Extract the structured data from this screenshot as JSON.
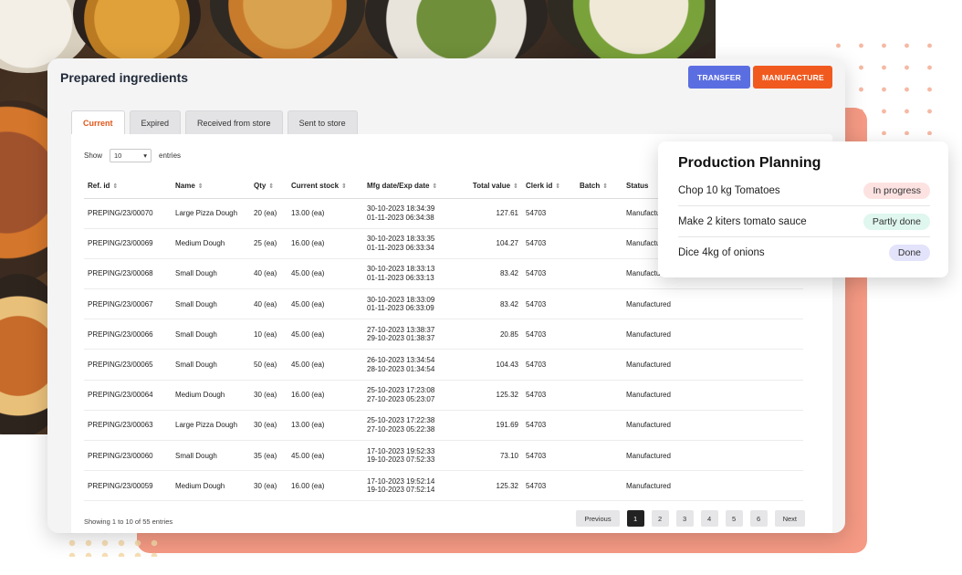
{
  "window": {
    "title": "Prepared ingredients"
  },
  "actions": {
    "transfer": "TRANSFER",
    "manufacture": "MANUFACTURE"
  },
  "tabs": [
    "Current",
    "Expired",
    "Received from store",
    "Sent to store"
  ],
  "length_menu": {
    "show": "Show",
    "value": "10",
    "entries": "entries"
  },
  "columns": [
    "Ref. id",
    "Name",
    "Qty",
    "Current stock",
    "Mfg date/Exp date",
    "Total value",
    "Clerk id",
    "Batch",
    "Status"
  ],
  "rows": [
    {
      "ref": "PREPING/23/00070",
      "name": "Large Pizza Dough",
      "qty": "20 (ea)",
      "stock": "13.00 (ea)",
      "mfg": "30-10-2023 18:34:39",
      "exp": "01-11-2023 06:34:38",
      "value": "127.61",
      "clerk": "54703",
      "batch": "",
      "status": "Manufactured"
    },
    {
      "ref": "PREPING/23/00069",
      "name": "Medium Dough",
      "qty": "25 (ea)",
      "stock": "16.00 (ea)",
      "mfg": "30-10-2023 18:33:35",
      "exp": "01-11-2023 06:33:34",
      "value": "104.27",
      "clerk": "54703",
      "batch": "",
      "status": "Manufactured"
    },
    {
      "ref": "PREPING/23/00068",
      "name": "Small Dough",
      "qty": "40 (ea)",
      "stock": "45.00 (ea)",
      "mfg": "30-10-2023 18:33:13",
      "exp": "01-11-2023 06:33:13",
      "value": "83.42",
      "clerk": "54703",
      "batch": "",
      "status": "Manufactured"
    },
    {
      "ref": "PREPING/23/00067",
      "name": "Small Dough",
      "qty": "40 (ea)",
      "stock": "45.00 (ea)",
      "mfg": "30-10-2023 18:33:09",
      "exp": "01-11-2023 06:33:09",
      "value": "83.42",
      "clerk": "54703",
      "batch": "",
      "status": "Manufactured"
    },
    {
      "ref": "PREPING/23/00066",
      "name": "Small Dough",
      "qty": "10 (ea)",
      "stock": "45.00 (ea)",
      "mfg": "27-10-2023 13:38:37",
      "exp": "29-10-2023 01:38:37",
      "value": "20.85",
      "clerk": "54703",
      "batch": "",
      "status": "Manufactured"
    },
    {
      "ref": "PREPING/23/00065",
      "name": "Small Dough",
      "qty": "50 (ea)",
      "stock": "45.00 (ea)",
      "mfg": "26-10-2023 13:34:54",
      "exp": "28-10-2023 01:34:54",
      "value": "104.43",
      "clerk": "54703",
      "batch": "",
      "status": "Manufactured"
    },
    {
      "ref": "PREPING/23/00064",
      "name": "Medium Dough",
      "qty": "30 (ea)",
      "stock": "16.00 (ea)",
      "mfg": "25-10-2023 17:23:08",
      "exp": "27-10-2023 05:23:07",
      "value": "125.32",
      "clerk": "54703",
      "batch": "",
      "status": "Manufactured"
    },
    {
      "ref": "PREPING/23/00063",
      "name": "Large Pizza Dough",
      "qty": "30 (ea)",
      "stock": "13.00 (ea)",
      "mfg": "25-10-2023 17:22:38",
      "exp": "27-10-2023 05:22:38",
      "value": "191.69",
      "clerk": "54703",
      "batch": "",
      "status": "Manufactured"
    },
    {
      "ref": "PREPING/23/00060",
      "name": "Small Dough",
      "qty": "35 (ea)",
      "stock": "45.00 (ea)",
      "mfg": "17-10-2023 19:52:33",
      "exp": "19-10-2023 07:52:33",
      "value": "73.10",
      "clerk": "54703",
      "batch": "",
      "status": "Manufactured"
    },
    {
      "ref": "PREPING/23/00059",
      "name": "Medium Dough",
      "qty": "30 (ea)",
      "stock": "16.00 (ea)",
      "mfg": "17-10-2023 19:52:14",
      "exp": "19-10-2023 07:52:14",
      "value": "125.32",
      "clerk": "54703",
      "batch": "",
      "status": "Manufactured"
    }
  ],
  "footer": {
    "info": "Showing 1 to 10 of 55 entries"
  },
  "pagination": {
    "previous": "Previous",
    "pages": [
      "1",
      "2",
      "3",
      "4",
      "5",
      "6"
    ],
    "next": "Next",
    "current": "1"
  },
  "planning": {
    "title": "Production Planning",
    "tasks": [
      {
        "label": "Chop 10 kg Tomatoes",
        "status": "In progress",
        "color": "#fde2e2"
      },
      {
        "label": "Make 2 kiters tomato sauce",
        "status": "Partly done",
        "color": "#dff7ee"
      },
      {
        "label": "Dice 4kg of onions",
        "status": "Done",
        "color": "#e3e3fb"
      }
    ]
  },
  "colors": {
    "transfer": "#5b6ee1",
    "manufacture": "#f05a1f",
    "active_tab": "#e0561a",
    "accent_card": "#f59a84"
  },
  "icons": {
    "sort": "sort-icon",
    "dropdown": "chevron-down-icon"
  }
}
